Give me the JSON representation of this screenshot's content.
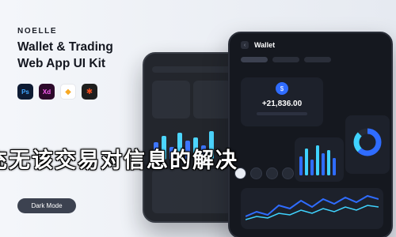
{
  "brand": "NOELLE",
  "headline": {
    "line1": "Wallet & Trading",
    "line2": "Web App UI Kit"
  },
  "app_icons": [
    {
      "icon": "photoshop-icon",
      "label": "Ps"
    },
    {
      "icon": "xd-icon",
      "label": "Xd"
    },
    {
      "icon": "sketch-icon",
      "label": "◆"
    },
    {
      "icon": "figma-icon",
      "label": "✱"
    }
  ],
  "mode_button": "Dark Mode",
  "phone": {
    "back_icon": "‹",
    "title": "Wallet",
    "balance_icon": "$",
    "balance": "+21,836.00"
  },
  "overlay_text": "充无该交易对信息的解决",
  "colors": {
    "accent_blue": "#2f6cff",
    "accent_cyan": "#3fd3ff",
    "phone_bg": "#15181f",
    "card_bg": "#1d212b"
  }
}
